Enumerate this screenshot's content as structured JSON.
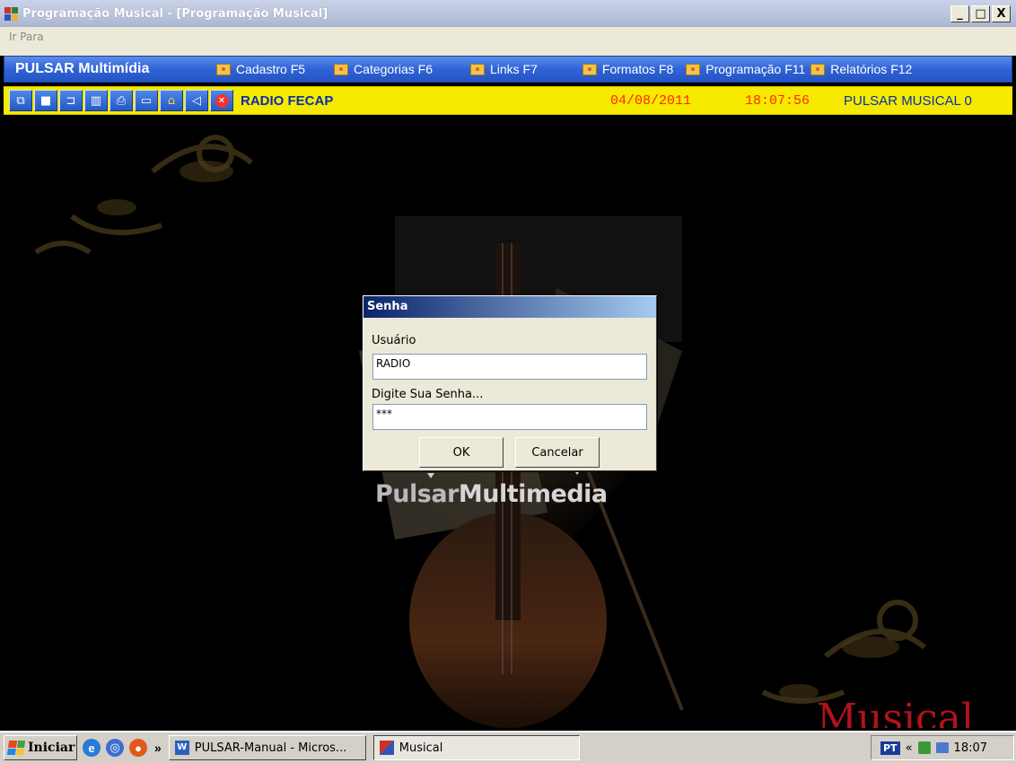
{
  "window": {
    "title": "Programação Musical - [Programação Musical]",
    "minimize": "_",
    "maximize": "□",
    "close": "X"
  },
  "menu": {
    "ir_para": "Ir Para"
  },
  "nav": {
    "brand": "PULSAR Multimídia",
    "items": [
      {
        "label": "Cadastro F5",
        "icon": "folder-icon"
      },
      {
        "label": "Categorias F6",
        "icon": "folder-icon"
      },
      {
        "label": "Links F7",
        "icon": "folder-icon"
      },
      {
        "label": "Formatos F8",
        "icon": "folder-icon"
      },
      {
        "label": "Programação F11",
        "icon": "folder-icon"
      },
      {
        "label": "Relatórios F12",
        "icon": "folder-icon"
      }
    ]
  },
  "toolbar": {
    "buttons": [
      "copy-icon",
      "save-icon",
      "open-folder-icon",
      "delete-icon",
      "print-icon",
      "monitor-icon",
      "home-icon",
      "sound-off-icon",
      "close-circle-icon"
    ],
    "station": "RADIO FECAP",
    "date": "04/08/2011",
    "time": "18:07:56",
    "label": "PULSAR MUSICAL  0"
  },
  "background": {
    "logo_part1": "Pulsar",
    "logo_part2": "Multimedia",
    "watermark": "Musical"
  },
  "dialog": {
    "title": "Senha",
    "user_label": "Usuário",
    "user_value": "RADIO",
    "password_label": "Digite Sua Senha...",
    "password_value": "***",
    "ok": "OK",
    "cancel": "Cancelar"
  },
  "taskbar": {
    "start": "Iniciar",
    "chevron": "»",
    "tasks": [
      {
        "label": "PULSAR-Manual - Micros...",
        "icon": "word-icon"
      },
      {
        "label": "Musical",
        "icon": "app-icon"
      }
    ],
    "tray": {
      "lang": "PT",
      "arrows": "«",
      "clock": "18:07"
    }
  },
  "colors": {
    "nav_blue": "#2f63d6",
    "toolbar_yellow": "#f5ea00",
    "accent_red": "#ff2a00",
    "station_blue": "#0b2ea8"
  }
}
